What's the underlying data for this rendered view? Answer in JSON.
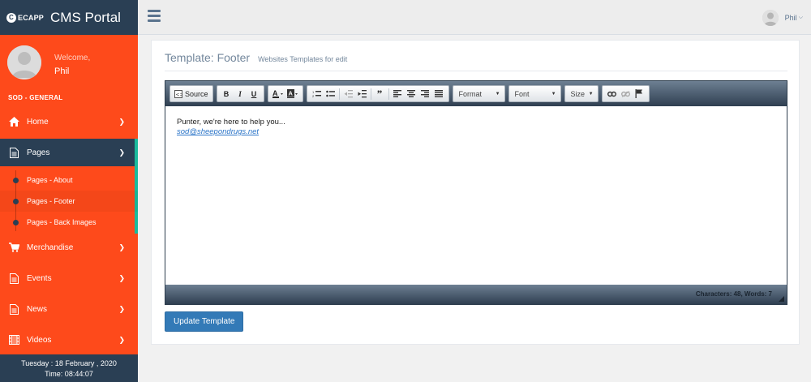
{
  "brand": {
    "logo_text": "ECAPP",
    "app_title": "CMS Portal"
  },
  "profile": {
    "welcome": "Welcome,",
    "name": "Phil"
  },
  "sidebar": {
    "section_label": "SOD - GENERAL",
    "items": [
      {
        "label": "Home",
        "icon": "home-icon"
      },
      {
        "label": "Pages",
        "icon": "file-icon"
      },
      {
        "label": "Merchandise",
        "icon": "cart-icon"
      },
      {
        "label": "Events",
        "icon": "file-icon"
      },
      {
        "label": "News",
        "icon": "file-icon"
      },
      {
        "label": "Videos",
        "icon": "film-icon"
      }
    ],
    "pages_submenu": [
      {
        "label": "Pages - About"
      },
      {
        "label": "Pages - Footer"
      },
      {
        "label": "Pages - Back Images"
      }
    ],
    "datetime": {
      "date": "Tuesday : 18 February , 2020",
      "time": "Time: 08:44:07"
    }
  },
  "topbar": {
    "user_name": "Phil"
  },
  "panel": {
    "title": "Template: Footer",
    "subtitle": "Websites Templates for edit"
  },
  "editor": {
    "toolbar": {
      "source_label": "Source",
      "bold": "B",
      "italic": "I",
      "underline": "U",
      "format_label": "Format",
      "font_label": "Font",
      "size_label": "Size"
    },
    "content": {
      "line1": "Punter, we're here to help you...",
      "link": "sod@sheepondrugs.net"
    },
    "status": "Characters: 48, Words: 7"
  },
  "actions": {
    "update_label": "Update Template"
  },
  "colors": {
    "sidebar": "#fe4a1b",
    "navy": "#2a3f54",
    "accent": "#1abb9c",
    "button": "#337ab7"
  }
}
